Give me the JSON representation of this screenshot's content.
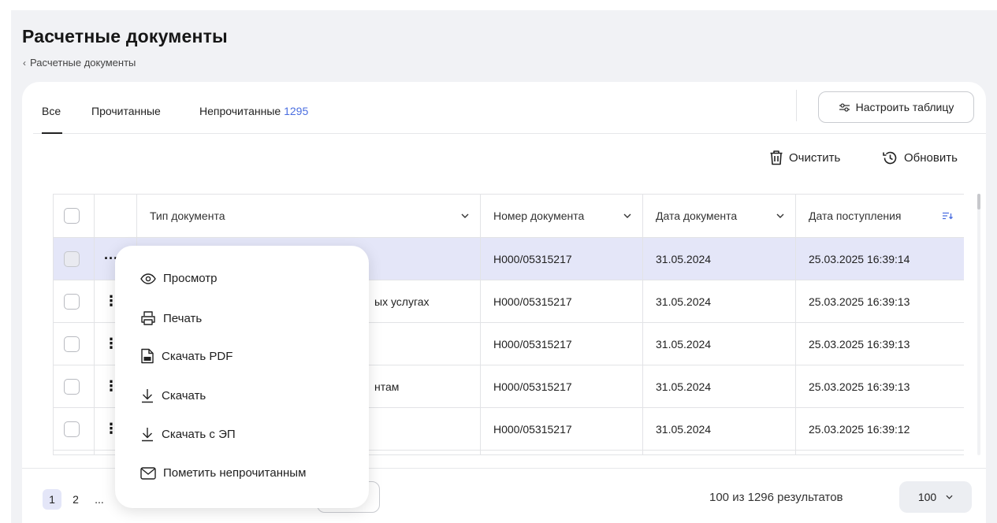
{
  "page": {
    "title": "Расчетные документы",
    "breadcrumb": "Расчетные документы"
  },
  "tabs": [
    {
      "label": "Все",
      "count": ""
    },
    {
      "label": "Прочитанные",
      "count": ""
    },
    {
      "label": "Непрочитанные",
      "count": "1295"
    }
  ],
  "toolbar": {
    "configure_label": "Настроить таблицу",
    "clear_label": "Очистить",
    "refresh_label": "Обновить"
  },
  "table": {
    "columns": [
      "Тип документа",
      "Номер документа",
      "Дата документа",
      "Дата поступления"
    ],
    "rows": [
      {
        "type": "",
        "number": "Н000/05315217",
        "doc_date": "31.05.2024",
        "received": "25.03.2025 16:39:14"
      },
      {
        "type": "ых услугах",
        "number": "Н000/05315217",
        "doc_date": "31.05.2024",
        "received": "25.03.2025 16:39:13"
      },
      {
        "type": "",
        "number": "Н000/05315217",
        "doc_date": "31.05.2024",
        "received": "25.03.2025 16:39:13"
      },
      {
        "type": "нтам",
        "number": "Н000/05315217",
        "doc_date": "31.05.2024",
        "received": "25.03.2025 16:39:13"
      },
      {
        "type": "",
        "number": "Н000/05315217",
        "doc_date": "31.05.2024",
        "received": "25.03.2025 16:39:12"
      }
    ]
  },
  "context_menu": {
    "items": [
      {
        "label": "Просмотр",
        "icon": "eye-icon"
      },
      {
        "label": "Печать",
        "icon": "printer-icon"
      },
      {
        "label": "Скачать PDF",
        "icon": "pdf-file-icon"
      },
      {
        "label": "Скачать",
        "icon": "download-icon"
      },
      {
        "label": "Скачать с ЭП",
        "icon": "download-icon"
      },
      {
        "label": "Пометить непрочитанным",
        "icon": "envelope-icon"
      }
    ]
  },
  "pagination": {
    "pages": [
      "1",
      "2",
      "..."
    ],
    "results_text": "100 из 1296 результатов",
    "page_size": "100"
  },
  "colors": {
    "accent": "#4a6ee0",
    "selected_row": "#e4e6f8",
    "page_bg": "#f1f2f5"
  }
}
